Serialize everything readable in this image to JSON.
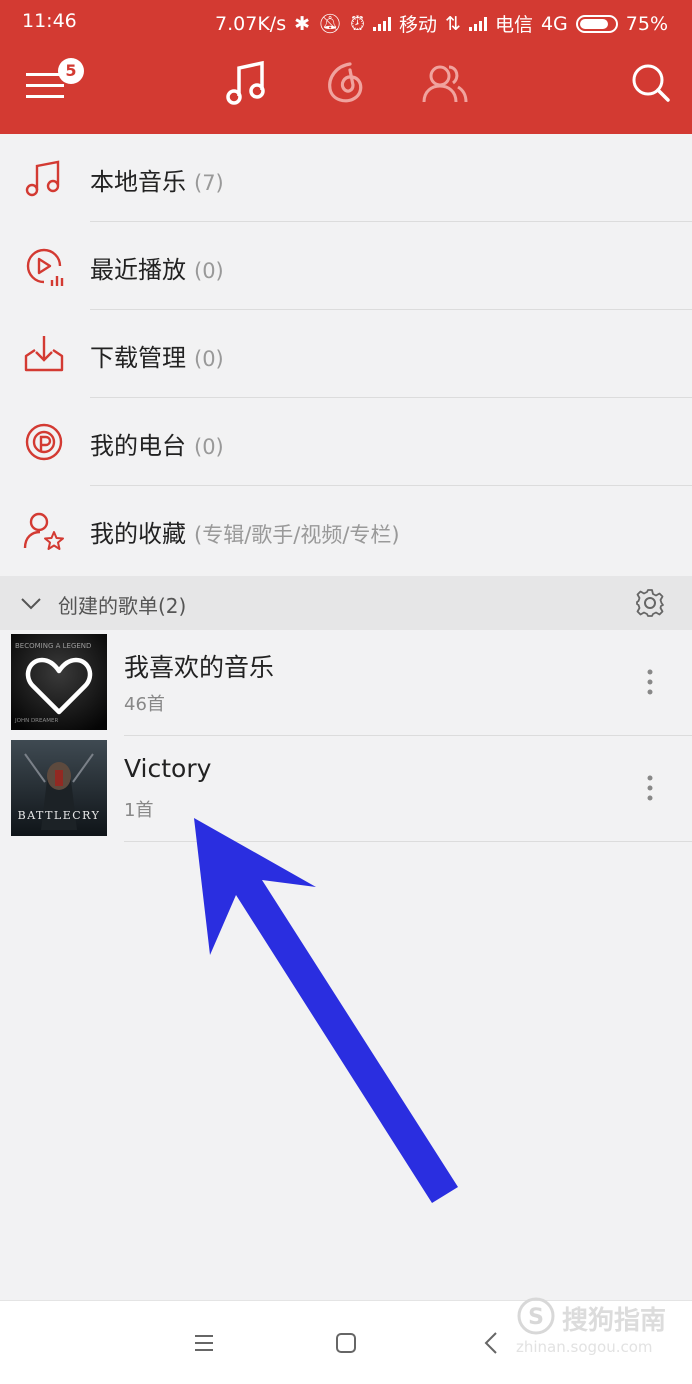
{
  "status_bar": {
    "time": "11:46",
    "speed": "7.07K/s",
    "carrier1": "移动",
    "carrier2": "电信",
    "network": "4G",
    "battery": "75%"
  },
  "header": {
    "menu_badge": "5",
    "tabs": [
      "music-note-icon",
      "netease-logo-icon",
      "friends-icon"
    ],
    "accent_color": "#d33a32"
  },
  "menu": {
    "items": [
      {
        "label": "本地音乐",
        "count": "(7)",
        "icon": "music-note-icon"
      },
      {
        "label": "最近播放",
        "count": "(0)",
        "icon": "recent-play-icon"
      },
      {
        "label": "下载管理",
        "count": "(0)",
        "icon": "download-icon"
      },
      {
        "label": "我的电台",
        "count": "(0)",
        "icon": "radio-icon"
      },
      {
        "label": "我的收藏",
        "count": "(专辑/歌手/视频/专栏)",
        "icon": "favorite-user-icon"
      }
    ]
  },
  "created_playlists": {
    "title": "创建的歌单(2)",
    "playlists": [
      {
        "name": "我喜欢的音乐",
        "count": "46首",
        "cover_text": "BECOMING A LEGEND",
        "cover_sub": "JOHN DREAMER"
      },
      {
        "name": "Victory",
        "count": "1首",
        "cover_text": "BATTLECRY"
      }
    ]
  },
  "watermark": {
    "text": "搜狗指南",
    "url": "zhinan.sogou.com"
  },
  "annotation_color": "#2a2ee0"
}
